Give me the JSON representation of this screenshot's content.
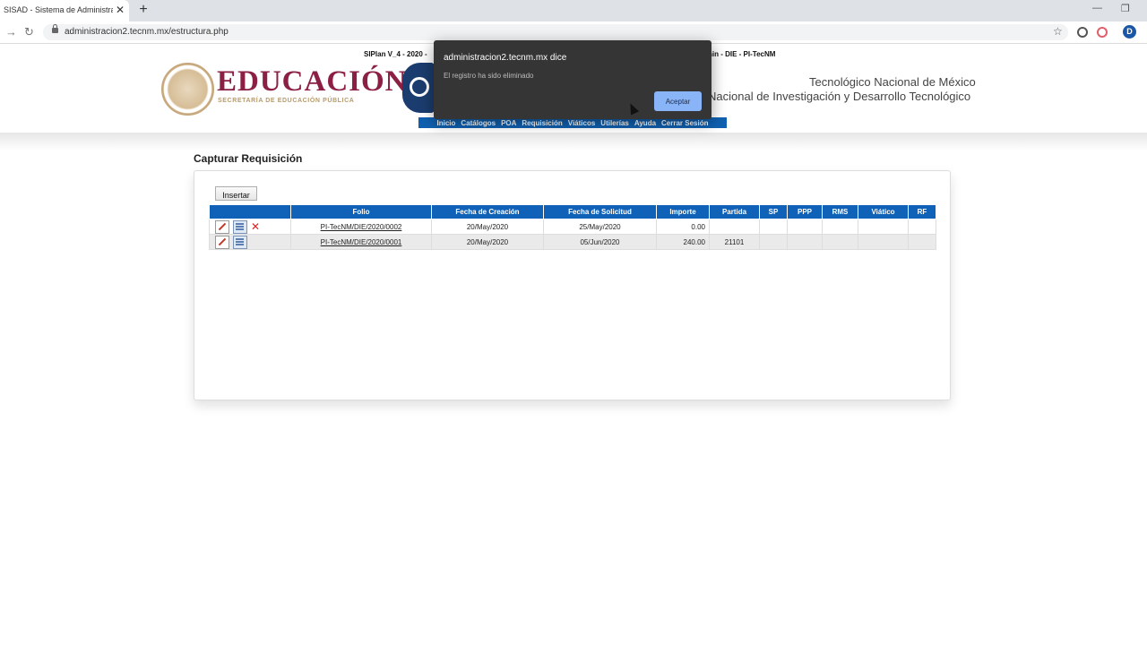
{
  "browser": {
    "tab_title": "SISAD - Sistema de Administraci",
    "url": "administracion2.tecnm.mx/estructura.php",
    "profile_initial": "D"
  },
  "header": {
    "topline_left": "SIPlan V_4 - 2020 -",
    "topline_right": "nin - DIE - PI-TecNM",
    "edu_title": "EDUCACIÓN",
    "edu_subtitle": "SECRETARÍA DE EDUCACIÓN PÚBLICA",
    "institution_line1": "Tecnológico Nacional de México",
    "institution_line2": "Nacional de Investigación y Desarrollo Tecnológico",
    "menu": [
      "Inicio",
      "Catálogos",
      "POA",
      "Requisición",
      "Viáticos",
      "Utilerías",
      "Ayuda",
      "Cerrar Sesión"
    ]
  },
  "main": {
    "title": "Capturar Requisición",
    "insert_label": "Insertar",
    "columns": [
      "",
      "Folio",
      "Fecha de Creación",
      "Fecha de Solicitud",
      "Importe",
      "Partida",
      "SP",
      "PPP",
      "RMS",
      "Viático",
      "RF"
    ],
    "rows": [
      {
        "folio": "PI-TecNM/DIE/2020/0002",
        "creacion": "20/May/2020",
        "solicitud": "25/May/2020",
        "importe": "0.00",
        "partida": "",
        "sp": "",
        "ppp": "",
        "rms": "",
        "viatico": "",
        "rf": ""
      },
      {
        "folio": "PI-TecNM/DIE/2020/0001",
        "creacion": "20/May/2020",
        "solicitud": "05/Jun/2020",
        "importe": "240.00",
        "partida": "21101",
        "sp": "",
        "ppp": "",
        "rms": "",
        "viatico": "",
        "rf": ""
      }
    ]
  },
  "alert": {
    "title": "administracion2.tecnm.mx dice",
    "message": "El registro ha sido eliminado",
    "ok_label": "Aceptar"
  }
}
